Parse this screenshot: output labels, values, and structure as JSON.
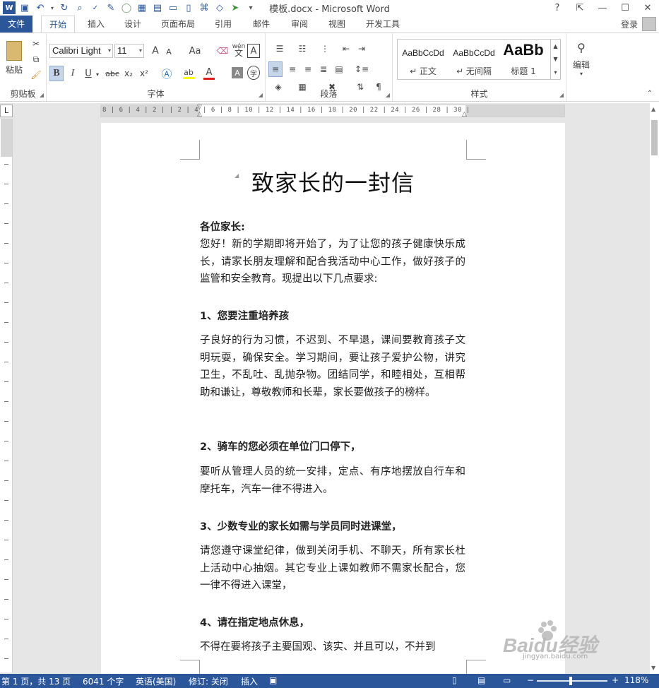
{
  "window": {
    "title": "模板.docx - Microsoft Word",
    "help": "?",
    "controls": [
      "restore-ribbon",
      "minimize",
      "maximize",
      "close"
    ]
  },
  "qat": {
    "items": [
      "word-icon",
      "save-icon",
      "undo-icon",
      "redo-icon",
      "print-preview-icon",
      "spelling-icon",
      "draw-icon",
      "record-icon",
      "table-icon",
      "page-icon",
      "new-icon",
      "open-icon",
      "branch-icon",
      "shape-icon",
      "arrow-icon",
      "more-icon"
    ]
  },
  "tabs": {
    "file": "文件",
    "home": "开始",
    "insert": "插入",
    "design": "设计",
    "layout": "页面布局",
    "references": "引用",
    "mailings": "邮件",
    "review": "审阅",
    "view": "视图",
    "developer": "开发工具"
  },
  "account": {
    "login": "登录"
  },
  "ribbon": {
    "clipboard": {
      "label": "剪贴板",
      "paste": "粘贴"
    },
    "font": {
      "label": "字体",
      "font_name": "Calibri Light",
      "font_size": "11",
      "grow": "A",
      "shrink": "A",
      "case": "Aa",
      "bold": "B",
      "italic": "I",
      "underline": "U",
      "strike": "abc",
      "subscript": "x₂",
      "superscript": "x²",
      "pinyin": "wén",
      "border_char": "A",
      "shade_char": "A",
      "enclose": "字"
    },
    "paragraph": {
      "label": "段落"
    },
    "styles": {
      "label": "样式",
      "items": [
        {
          "preview": "AaBbCcDd",
          "name": "↵ 正文"
        },
        {
          "preview": "AaBbCcDd",
          "name": "↵ 无间隔"
        },
        {
          "preview": "AaBb",
          "name": "标题 1"
        }
      ]
    },
    "editing": {
      "label": "编辑"
    }
  },
  "ruler": {
    "numbers": "8 | 6 | 4 | 2 |  | 2 | 4 | 6 | 8 | 10 | 12 | 14 | 16 | 18 | 20 | 22 | 24 | 26 | 28 | 30 |"
  },
  "document": {
    "title": "致家长的一封信",
    "greeting": "各位家长:",
    "intro": "您好！新的学期即将开始了，为了让您的孩子健康快乐成长，请家长朋友理解和配合我活动中心工作，做好孩子的监管和安全教育。现提出以下几点要求:",
    "h1": "1、您要注重培养孩",
    "p1": "子良好的行为习惯，不迟到、不早退，课间要教育孩子文明玩耍，确保安全。学习期间，要让孩子爱护公物，讲究卫生，不乱吐、乱抛杂物。团结同学，和睦相处，互相帮助和谦让，尊敬教师和长辈，家长要做孩子的榜样。",
    "h2": "2、骑车的您必须在单位门口停下，",
    "p2": "要听从管理人员的统一安排，定点、有序地摆放自行车和摩托车，汽车一律不得进入。",
    "h3": "3、少数专业的家长如需与学员同时进课堂，",
    "p3": "请您遵守课堂纪律，做到关闭手机、不聊天，所有家长杜上活动中心抽烟。其它专业上课如教师不需家长配合，您一律不得进入课堂，",
    "h4": "4、请在指定地点休息，",
    "p4": "不得在要将孩子主要国观、该实、并且可以，不并到"
  },
  "status": {
    "page": "第 1 页，共 13 页",
    "words": "6041 个字",
    "language": "英语(美国)",
    "track": "修订: 关闭",
    "insert": "插入",
    "zoom": "118%"
  },
  "watermark": {
    "brand": "Baidu经验",
    "url": "jingyan.baidu.com"
  },
  "colors": {
    "accent": "#2b579a",
    "workspace": "#e6e6e6"
  }
}
